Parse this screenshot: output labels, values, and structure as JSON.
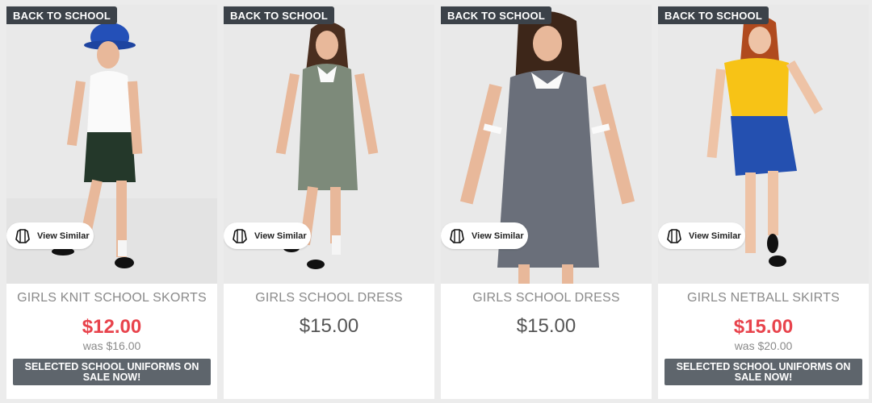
{
  "products": [
    {
      "badge": "BACK TO SCHOOL",
      "view_similar": "View Similar",
      "title": "GIRLS KNIT SCHOOL SKORTS",
      "price": "$12.00",
      "was": "was $16.00",
      "promo": "SELECTED SCHOOL UNIFORMS ON SALE NOW!",
      "image_icon": "girl-hat-skort-photo"
    },
    {
      "badge": "BACK TO SCHOOL",
      "view_similar": "View Similar",
      "title": "GIRLS SCHOOL DRESS",
      "price": "$15.00",
      "image_icon": "girl-green-dress-photo"
    },
    {
      "badge": "BACK TO SCHOOL",
      "view_similar": "View Similar",
      "title": "GIRLS SCHOOL DRESS",
      "price": "$15.00",
      "image_icon": "girl-navy-dress-photo"
    },
    {
      "badge": "BACK TO SCHOOL",
      "view_similar": "View Similar",
      "title": "GIRLS NETBALL SKIRTS",
      "price": "$15.00",
      "was": "was $20.00",
      "promo": "SELECTED SCHOOL UNIFORMS ON SALE NOW!",
      "image_icon": "girl-yellow-top-blue-skirt-photo"
    }
  ],
  "colors": {
    "badge_bg": "#3c4249",
    "sale_price": "#e8434c",
    "regular_price": "#555555",
    "promo_bg": "#5e656c"
  }
}
